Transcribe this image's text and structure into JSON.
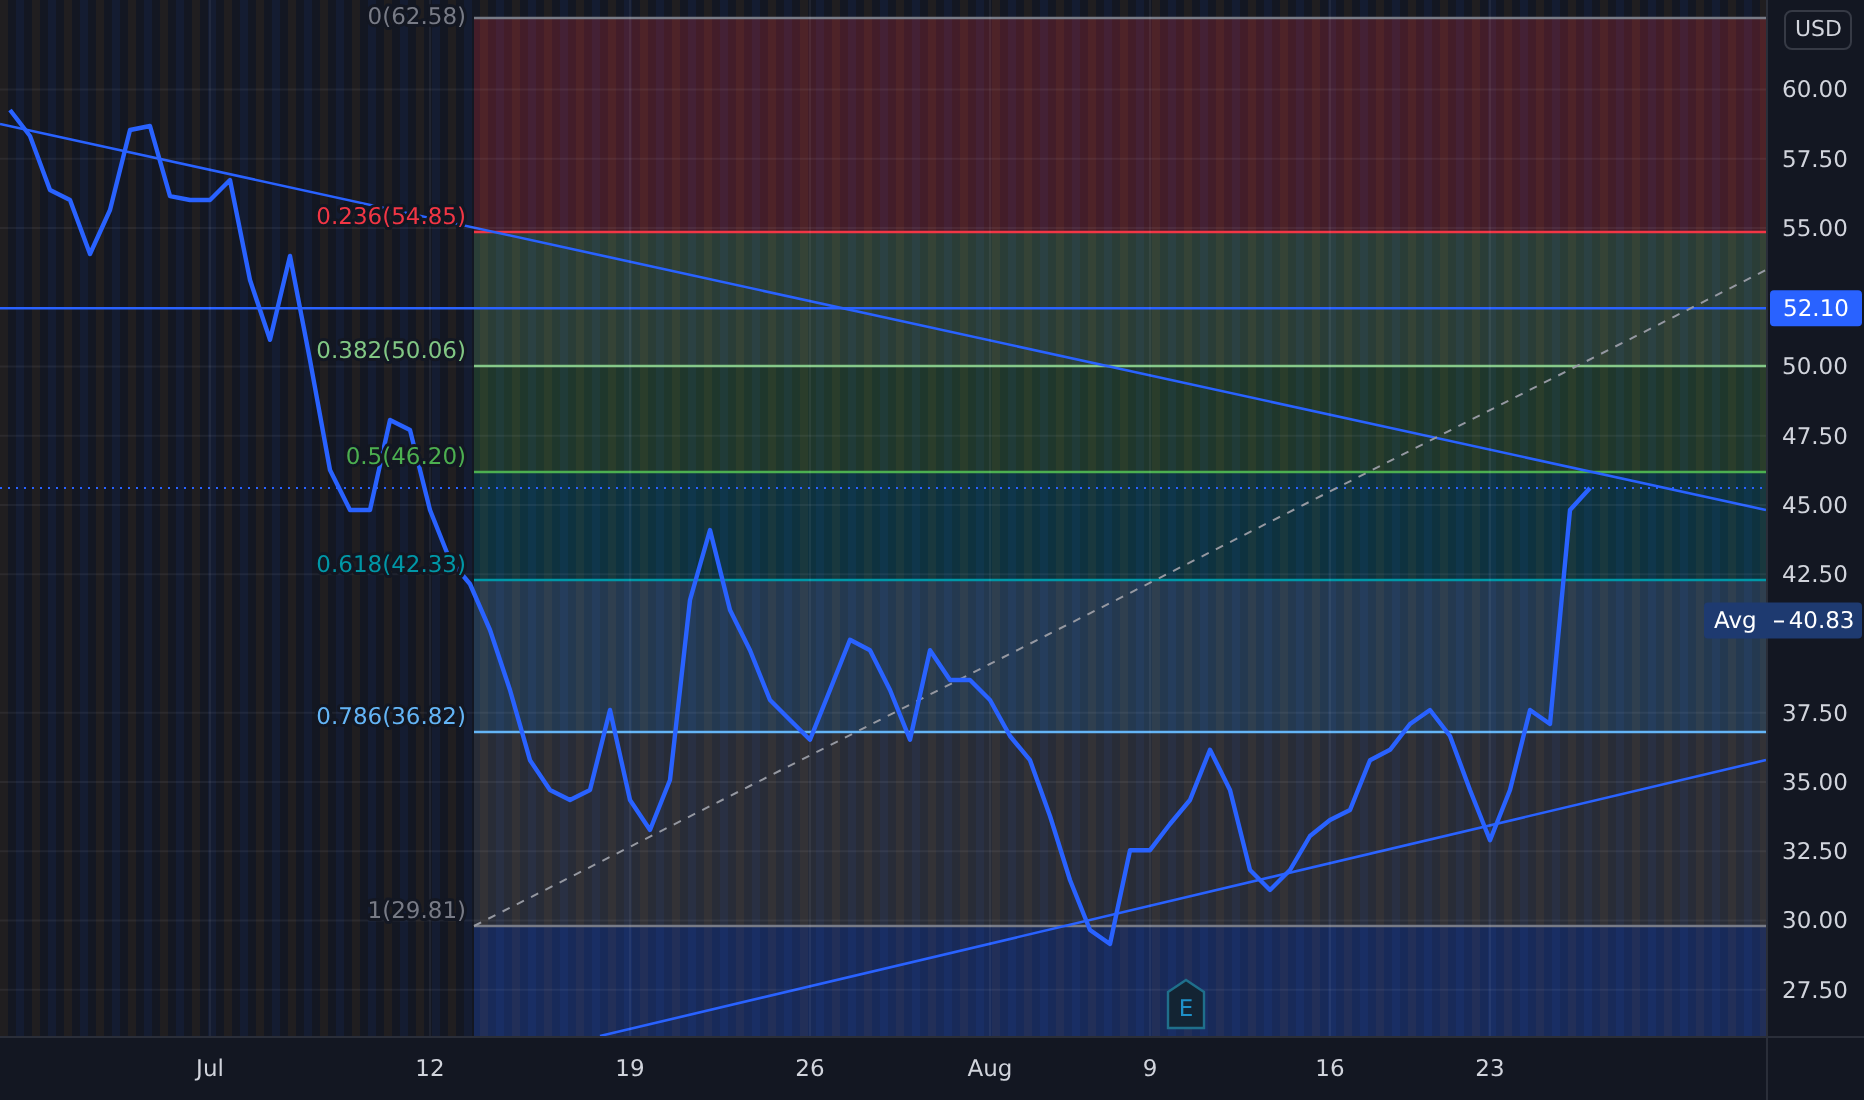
{
  "currency_button": "USD",
  "avg_tag": {
    "label": "Avg",
    "value": "40.83"
  },
  "line_tag": {
    "label": "52.10"
  },
  "event_marker": {
    "label": "E"
  },
  "fib_levels": [
    {
      "label": "0(62.58)",
      "color": "#787b86"
    },
    {
      "label": "0.236(54.85)",
      "color": "#f23645"
    },
    {
      "label": "0.382(50.06)",
      "color": "#81c784"
    },
    {
      "label": "0.5(46.20)",
      "color": "#4caf50"
    },
    {
      "label": "0.618(42.33)",
      "color": "#0097a7"
    },
    {
      "label": "0.786(36.82)",
      "color": "#64b5f6"
    },
    {
      "label": "1(29.81)",
      "color": "#787b86"
    }
  ],
  "chart": {
    "chart_data": {
      "type": "line",
      "grid": true,
      "categories": [
        null,
        null,
        null,
        null,
        null,
        null,
        null,
        null,
        null,
        null,
        "Jul",
        null,
        null,
        null,
        null,
        null,
        null,
        null,
        null,
        null,
        null,
        "12",
        null,
        null,
        null,
        null,
        null,
        null,
        null,
        null,
        null,
        "19",
        null,
        null,
        null,
        null,
        null,
        null,
        null,
        null,
        "26",
        null,
        null,
        null,
        null,
        null,
        null,
        null,
        null,
        "Aug",
        null,
        null,
        null,
        null,
        null,
        null,
        null,
        "9",
        null,
        null,
        null,
        null,
        null,
        null,
        null,
        null,
        "16",
        null,
        null,
        null,
        null,
        null,
        null,
        null,
        "23",
        null,
        null,
        null,
        null,
        null
      ],
      "series": [
        {
          "color": "#2962ff",
          "values": [
            59.26,
            58.32,
            56.37,
            56.01,
            54.06,
            55.65,
            58.54,
            58.68,
            56.15,
            56.01,
            56.01,
            56.73,
            53.12,
            50.96,
            53.99,
            50.23,
            46.26,
            44.82,
            44.82,
            48.07,
            47.71,
            44.82,
            43.01,
            42.15,
            40.49,
            38.32,
            35.79,
            34.71,
            34.35,
            34.71,
            37.6,
            34.35,
            33.27,
            35.07,
            41.57,
            44.1,
            41.21,
            39.76,
            37.96,
            37.24,
            36.52,
            38.32,
            40.13,
            39.76,
            38.32,
            36.52,
            39.76,
            38.68,
            38.68,
            37.96,
            36.66,
            35.79,
            33.77,
            31.46,
            29.66,
            29.15,
            32.54,
            32.54,
            33.48,
            34.35,
            36.16,
            34.71,
            31.82,
            31.1,
            31.82,
            33.05,
            33.63,
            33.99,
            35.79,
            36.16,
            37.09,
            37.6,
            36.66,
            34.71,
            32.9,
            34.71,
            37.6,
            37.09,
            44.82,
            45.61
          ]
        }
      ],
      "ylim": [
        25.83,
        63.23
      ],
      "yticks": [
        {
          "value": 60,
          "label": "60.00"
        },
        {
          "value": 57.5,
          "label": "57.50"
        },
        {
          "value": 55,
          "label": "55.00"
        },
        {
          "value": 50,
          "label": "50.00"
        },
        {
          "value": 47.5,
          "label": "47.50"
        },
        {
          "value": 45,
          "label": "45.00"
        },
        {
          "value": 42.5,
          "label": "42.50"
        },
        {
          "value": 37.5,
          "label": "37.50"
        },
        {
          "value": 35,
          "label": "35.00"
        },
        {
          "value": 32.5,
          "label": "32.50"
        },
        {
          "value": 30,
          "label": "30.00"
        },
        {
          "value": 27.5,
          "label": "27.50"
        }
      ]
    }
  }
}
